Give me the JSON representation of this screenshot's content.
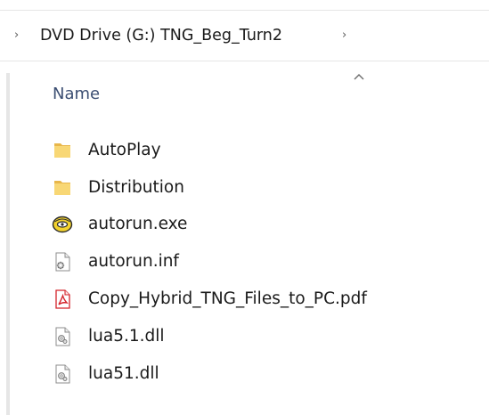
{
  "breadcrumb": {
    "lead_chevron": "›",
    "path": "DVD Drive (G:) TNG_Beg_Turn2",
    "trail_chevron": "›"
  },
  "columns": {
    "name_label": "Name",
    "sort_indicator": "chevron-up-icon"
  },
  "files": [
    {
      "name": "AutoPlay",
      "icon": "folder-icon"
    },
    {
      "name": "Distribution",
      "icon": "folder-icon"
    },
    {
      "name": "autorun.exe",
      "icon": "disc-exe-icon"
    },
    {
      "name": "autorun.inf",
      "icon": "settings-file-icon"
    },
    {
      "name": "Copy_Hybrid_TNG_Files_to_PC.pdf",
      "icon": "pdf-icon"
    },
    {
      "name": "lua5.1.dll",
      "icon": "dll-file-icon"
    },
    {
      "name": "lua51.dll",
      "icon": "dll-file-icon"
    }
  ],
  "colors": {
    "folder": "#f8d775",
    "header_text": "#3b4e72",
    "pdf_red": "#d4242b"
  }
}
